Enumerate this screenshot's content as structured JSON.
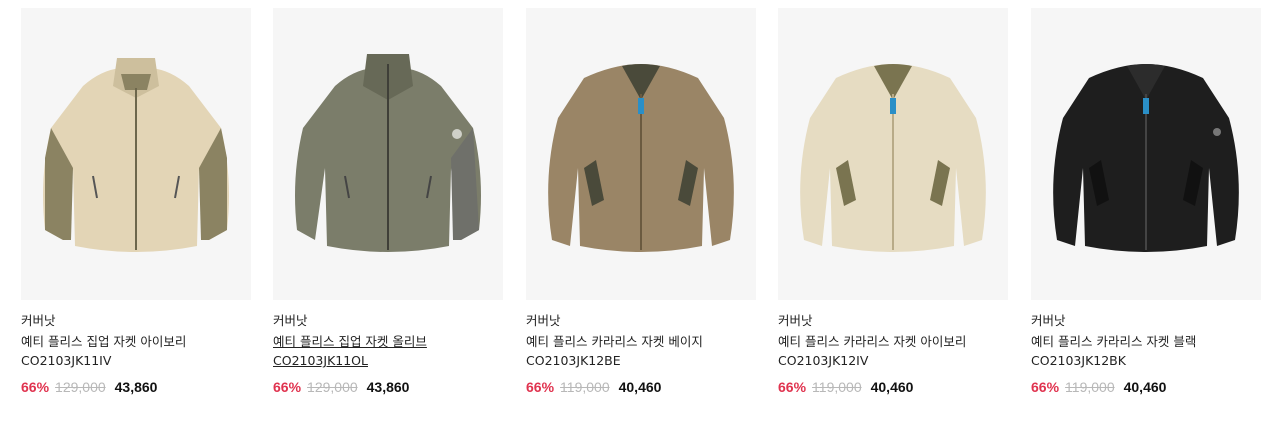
{
  "products": [
    {
      "brand": "커버낫",
      "name": "예티 플리스 집업 자켓 아이보리",
      "code": "CO2103JK11IV",
      "discount": "66%",
      "original_price": "129,000",
      "final_price": "43,860",
      "image_icon": "fleece-zip-jacket-ivory-image",
      "colors": {
        "body": "#e3d5b6",
        "accent": "#8b8362",
        "shadow": "#cdbf9d"
      }
    },
    {
      "brand": "커버낫",
      "name": "예티 플리스 집업 자켓 올리브",
      "code": "CO2103JK11OL",
      "discount": "66%",
      "original_price": "129,000",
      "final_price": "43,860",
      "image_icon": "fleece-zip-jacket-olive-image",
      "colors": {
        "body": "#7b7d6a",
        "accent": "#6f706a",
        "shadow": "#676957"
      }
    },
    {
      "brand": "커버낫",
      "name": "예티 플리스 카라리스 자켓 베이지",
      "code": "CO2103JK12BE",
      "discount": "66%",
      "original_price": "119,000",
      "final_price": "40,460",
      "image_icon": "fleece-collarless-jacket-beige-image",
      "colors": {
        "body": "#9a8566",
        "accent": "#4a4a3a",
        "shadow": "#857154"
      }
    },
    {
      "brand": "커버낫",
      "name": "예티 플리스 카라리스 자켓 아이보리",
      "code": "CO2103JK12IV",
      "discount": "66%",
      "original_price": "119,000",
      "final_price": "40,460",
      "image_icon": "fleece-collarless-jacket-ivory-image",
      "colors": {
        "body": "#e6dcc2",
        "accent": "#7a7450",
        "shadow": "#d2c6a8"
      }
    },
    {
      "brand": "커버낫",
      "name": "예티 플리스 카라리스 자켓 블랙",
      "code": "CO2103JK12BK",
      "discount": "66%",
      "original_price": "119,000",
      "final_price": "40,460",
      "image_icon": "fleece-collarless-jacket-black-image",
      "colors": {
        "body": "#1e1e1e",
        "accent": "#2c2c2c",
        "shadow": "#111111"
      }
    }
  ],
  "hovered_index": 1,
  "zipper_accent": "#2a8fc7"
}
